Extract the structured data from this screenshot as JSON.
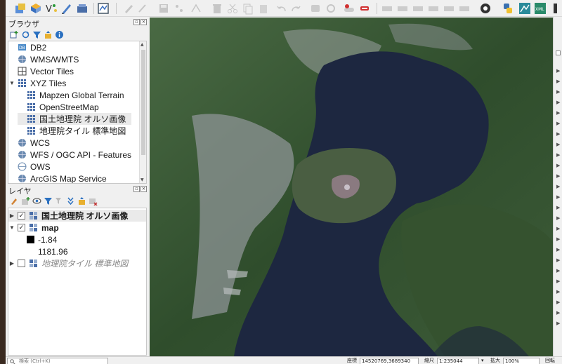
{
  "browser_panel": {
    "title": "ブラウザ",
    "items": [
      {
        "label": "DB2",
        "icon": "db2-icon"
      },
      {
        "label": "WMS/WMTS",
        "icon": "globe-icon"
      },
      {
        "label": "Vector Tiles",
        "icon": "vector-tiles-icon"
      },
      {
        "label": "XYZ Tiles",
        "icon": "xyz-tiles-icon",
        "expanded": true
      },
      {
        "label": "Mapzen Global Terrain",
        "icon": "xyz-tile-icon"
      },
      {
        "label": "OpenStreetMap",
        "icon": "xyz-tile-icon"
      },
      {
        "label": "国土地理院 オルソ画像",
        "icon": "xyz-tile-icon",
        "selected": true
      },
      {
        "label": "地理院タイル 標準地図",
        "icon": "xyz-tile-icon"
      },
      {
        "label": "WCS",
        "icon": "globe-icon"
      },
      {
        "label": "WFS / OGC API - Features",
        "icon": "globe-icon"
      },
      {
        "label": "OWS",
        "icon": "globe-icon"
      },
      {
        "label": "ArcGIS Map Service",
        "icon": "globe-icon"
      }
    ]
  },
  "layers_panel": {
    "title": "レイヤ",
    "layers": [
      {
        "label": "国土地理院 オルソ画像",
        "checked": true,
        "bold": true
      },
      {
        "label": "map",
        "checked": true,
        "bold": true
      },
      {
        "label": "-1.84"
      },
      {
        "label": "1181.96"
      },
      {
        "label": "地理院タイル 標準地図",
        "checked": false,
        "italic": true
      }
    ]
  },
  "statusbar": {
    "search_placeholder": "検索 (Ctrl+K)",
    "coord_label": "座標",
    "coord_value": "14520769,3689340",
    "scale_label": "縮尺",
    "scale_value": "1:235044",
    "magnifier_label": "拡大",
    "magnifier_value": "100%",
    "rotation_label": "回転"
  },
  "colors": {
    "water": "#1d2740",
    "land": "#3d5b38",
    "urban": "#8e9496"
  }
}
